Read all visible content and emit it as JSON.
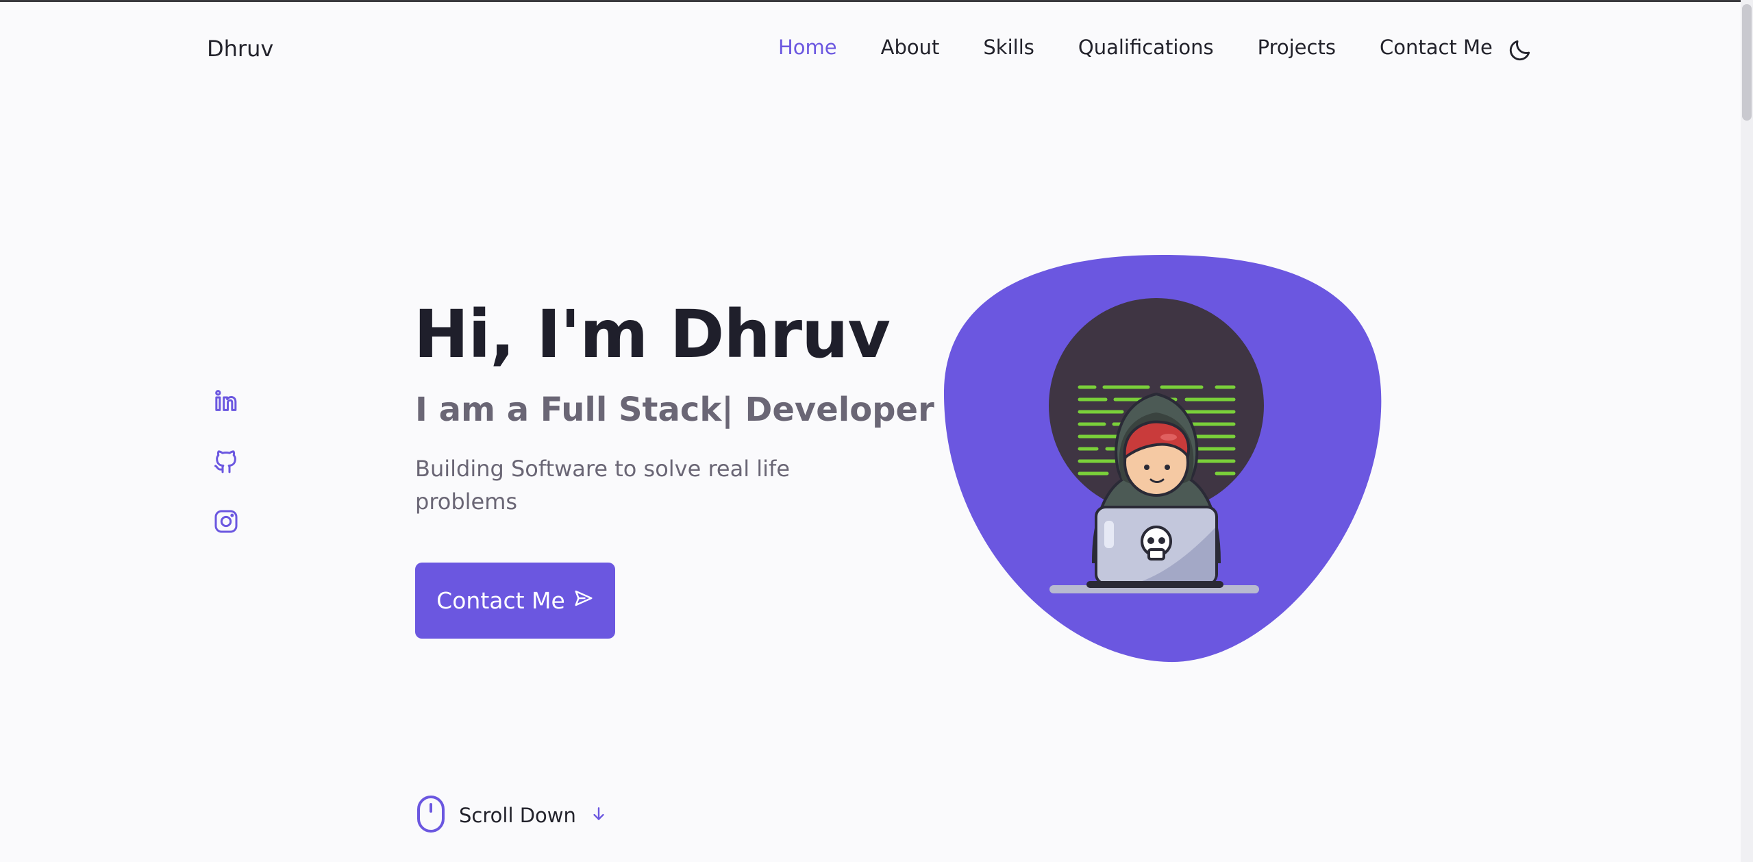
{
  "header": {
    "logo": "Dhruv",
    "nav": [
      {
        "label": "Home",
        "active": true
      },
      {
        "label": "About",
        "active": false
      },
      {
        "label": "Skills",
        "active": false
      },
      {
        "label": "Qualifications",
        "active": false
      },
      {
        "label": "Projects",
        "active": false
      },
      {
        "label": "Contact Me",
        "active": false
      }
    ],
    "theme_icon": "moon-icon"
  },
  "social": [
    {
      "name": "linkedin-icon"
    },
    {
      "name": "github-icon"
    },
    {
      "name": "instagram-icon"
    }
  ],
  "hero": {
    "title": "Hi, I'm Dhruv",
    "subtitle": "I am a Full Stack| Developer",
    "description": "Building Software to solve real life problems",
    "button_label": "Contact Me",
    "button_icon": "send-icon",
    "illustration": "developer-with-laptop-illustration"
  },
  "scroll": {
    "label": "Scroll Down",
    "mouse_icon": "mouse-icon",
    "arrow_icon": "arrow-down-icon"
  },
  "colors": {
    "accent": "#6b57e0",
    "text": "#1f1f2b",
    "muted": "#6a6675",
    "background": "#fafafc"
  }
}
